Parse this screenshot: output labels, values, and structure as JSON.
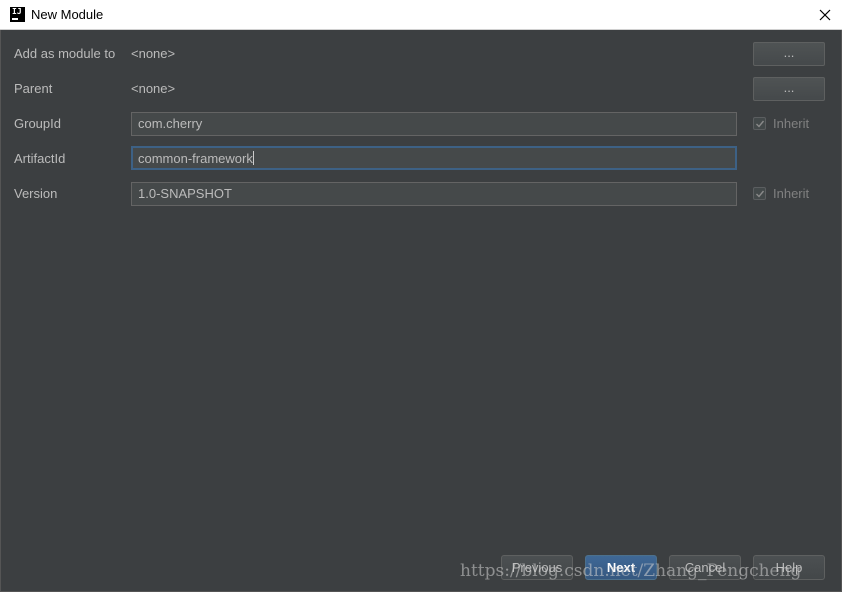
{
  "window": {
    "title": "New Module",
    "app_icon_text": "IJ"
  },
  "form": {
    "add_as_module_to": {
      "label": "Add as module to",
      "value": "<none>",
      "browse_label": "..."
    },
    "parent": {
      "label": "Parent",
      "value": "<none>",
      "browse_label": "..."
    },
    "group_id": {
      "label": "GroupId",
      "value": "com.cherry",
      "inherit_label": "Inherit",
      "inherit_checked": true
    },
    "artifact_id": {
      "label": "ArtifactId",
      "value": "common-framework"
    },
    "version": {
      "label": "Version",
      "value": "1.0-SNAPSHOT",
      "inherit_label": "Inherit",
      "inherit_checked": true
    }
  },
  "buttons": {
    "previous": "Previous",
    "next": "Next",
    "cancel": "Cancel",
    "help": "Help"
  },
  "watermark": "https://blog.csdn.net/Zhang_Pengcheng",
  "colors": {
    "background": "#3c3f41",
    "field_background": "#45494a",
    "focus_border": "#3d6185",
    "primary_button": "#365880",
    "text": "#bbbbbb"
  }
}
